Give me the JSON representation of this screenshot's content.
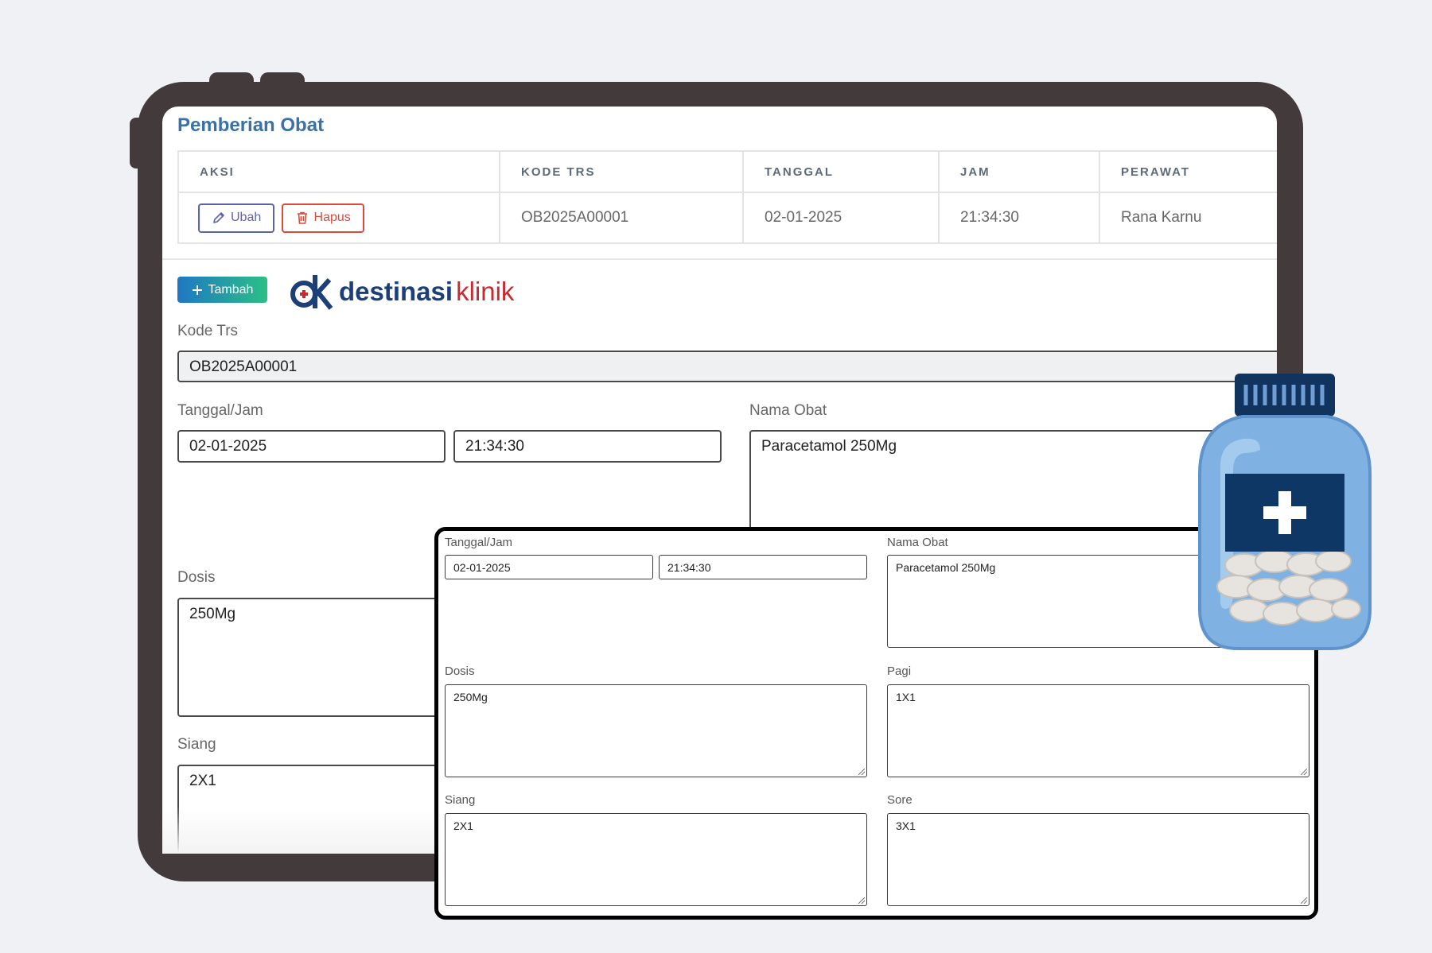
{
  "page": {
    "title": "Pemberian Obat"
  },
  "table": {
    "headers": [
      "AKSI",
      "KODE TRS",
      "TANGGAL",
      "JAM",
      "PERAWAT"
    ],
    "rows": [
      {
        "edit_label": "Ubah",
        "delete_label": "Hapus",
        "kode_trs": "OB2025A00001",
        "tanggal": "02-01-2025",
        "jam": "21:34:30",
        "perawat": "Rana Karnu"
      }
    ]
  },
  "toolbar": {
    "add_label": "Tambah"
  },
  "logo": {
    "word1": "destinasi",
    "word2": "klinik"
  },
  "form": {
    "kode_trs_label": "Kode Trs",
    "kode_trs_value": "OB2025A00001",
    "tanggal_jam_label": "Tanggal/Jam",
    "tanggal_value": "02-01-2025",
    "jam_value": "21:34:30",
    "nama_obat_label": "Nama Obat",
    "nama_obat_value": "Paracetamol 250Mg",
    "dosis_label": "Dosis",
    "dosis_value": "250Mg",
    "siang_label": "Siang",
    "siang_value": "2X1"
  },
  "panel": {
    "tanggal_jam_label": "Tanggal/Jam",
    "tanggal_value": "02-01-2025",
    "jam_value": "21:34:30",
    "nama_obat_label": "Nama Obat",
    "nama_obat_value": "Paracetamol 250Mg",
    "dosis_label": "Dosis",
    "dosis_value": "250Mg",
    "pagi_label": "Pagi",
    "pagi_value": "1X1",
    "siang_label": "Siang",
    "siang_value": "2X1",
    "sore_label": "Sore",
    "sore_value": "3X1"
  },
  "icons": {
    "edit": "pencil-icon",
    "delete": "trash-icon",
    "add": "plus-icon",
    "illustration": "medicine-bottle-icon"
  },
  "colors": {
    "frame": "#433a3b",
    "title": "#3a72a6",
    "edit_button": "#5d63aa",
    "delete_button": "#dc4a3a",
    "logo_primary": "#1d3f79",
    "logo_accent": "#c92a2f",
    "add_gradient_start": "#1e78c4",
    "add_gradient_end": "#2bbf86"
  }
}
